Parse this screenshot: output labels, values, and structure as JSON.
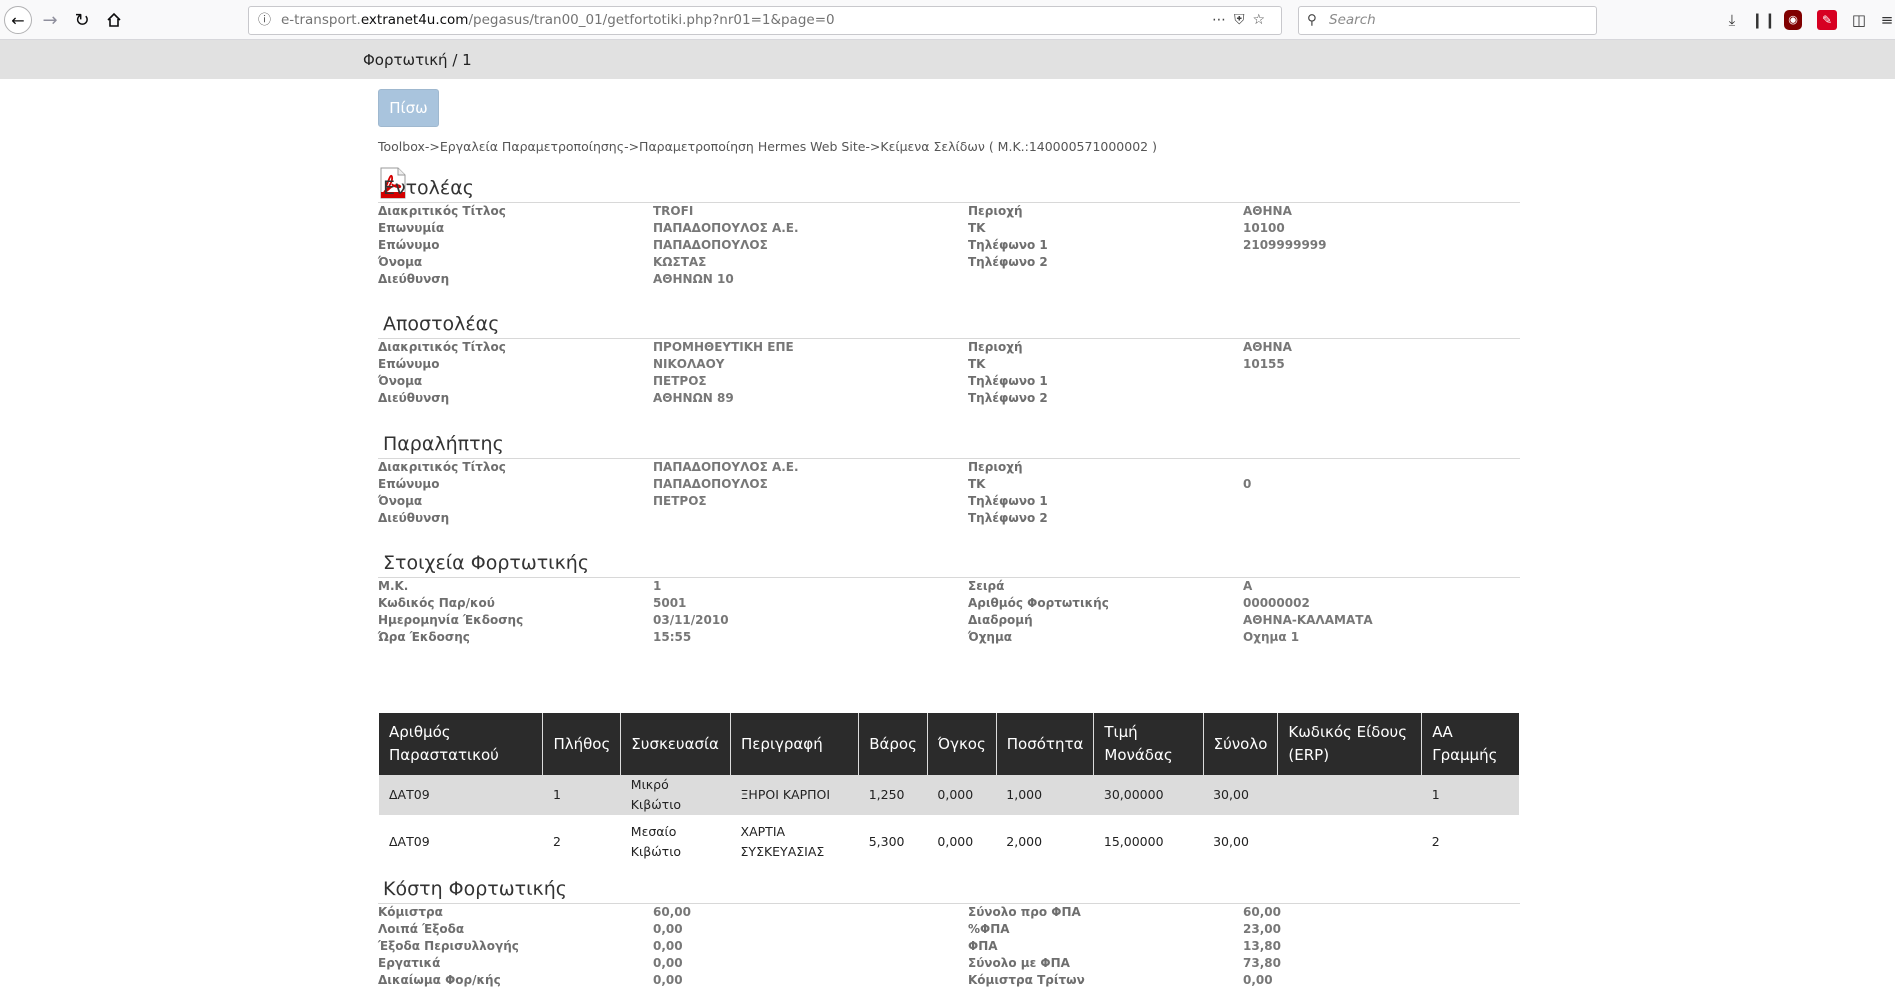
{
  "browser": {
    "url_prefix": "e-transport.",
    "url_host": "extranet4u.com",
    "url_path": "/pegasus/tran00_01/getfortotiki.php?nr01=1&page=0",
    "search_placeholder": "Search"
  },
  "header": {
    "title": "Φορτωτική / 1"
  },
  "back_button": "Πίσω",
  "breadcrumb": "Toolbox->Εργαλεία Παραμετροποίησης->Παραμετροποίηση Hermes Web Site->Κείμενα Σελίδων ( Μ.Κ.:140000571000002 )",
  "sections": {
    "entoleas": {
      "title": "Εντολέας",
      "rows": [
        {
          "k1": "Διακριτικός Τίτλος",
          "v1": "TROFI",
          "k2": "Περιοχή",
          "v2": "ΑΘΗΝΑ"
        },
        {
          "k1": "Επωνυμία",
          "v1": "ΠΑΠΑΔΟΠΟΥΛΟΣ Α.Ε.",
          "k2": "ΤΚ",
          "v2": "10100"
        },
        {
          "k1": "Επώνυμο",
          "v1": "ΠΑΠΑΔΟΠΟΥΛΟΣ",
          "k2": "Τηλέφωνο 1",
          "v2": "2109999999"
        },
        {
          "k1": "Όνομα",
          "v1": "ΚΩΣΤΑΣ",
          "k2": "Τηλέφωνο 2",
          "v2": ""
        },
        {
          "k1": "Διεύθυνση",
          "v1": "ΑΘΗΝΩΝ 10",
          "k2": "",
          "v2": ""
        }
      ]
    },
    "apostoleas": {
      "title": "Αποστολέας",
      "rows": [
        {
          "k1": "Διακριτικός Τίτλος",
          "v1": "ΠΡΟΜΗΘΕΥΤΙΚΗ ΕΠΕ",
          "k2": "Περιοχή",
          "v2": "ΑΘΗΝΑ"
        },
        {
          "k1": "Επώνυμο",
          "v1": "ΝΙΚΟΛΑΟΥ",
          "k2": "ΤΚ",
          "v2": "10155"
        },
        {
          "k1": "Όνομα",
          "v1": "ΠΕΤΡΟΣ",
          "k2": "Τηλέφωνο 1",
          "v2": ""
        },
        {
          "k1": "Διεύθυνση",
          "v1": "ΑΘΗΝΩΝ 89",
          "k2": "Τηλέφωνο 2",
          "v2": ""
        }
      ]
    },
    "paraliptis": {
      "title": "Παραλήπτης",
      "rows": [
        {
          "k1": "Διακριτικός Τίτλος",
          "v1": "ΠΑΠΑΔΟΠΟΥΛΟΣ Α.Ε.",
          "k2": "Περιοχή",
          "v2": ""
        },
        {
          "k1": "Επώνυμο",
          "v1": "ΠΑΠΑΔΟΠΟΥΛΟΣ",
          "k2": "ΤΚ",
          "v2": "0"
        },
        {
          "k1": "Όνομα",
          "v1": "ΠΕΤΡΟΣ",
          "k2": "Τηλέφωνο 1",
          "v2": ""
        },
        {
          "k1": "Διεύθυνση",
          "v1": "",
          "k2": "Τηλέφωνο 2",
          "v2": ""
        }
      ]
    },
    "stoixeia": {
      "title": "Στοιχεία Φορτωτικής",
      "rows": [
        {
          "k1": "Μ.Κ.",
          "v1": "1",
          "k2": "Σειρά",
          "v2": "Α"
        },
        {
          "k1": "Κωδικός Παρ/κού",
          "v1": "5001",
          "k2": "Αριθμός Φορτωτικής",
          "v2": "00000002"
        },
        {
          "k1": "Ημερομηνία Έκδοσης",
          "v1": "03/11/2010",
          "k2": "Διαδρομή",
          "v2": "ΑΘΗΝΑ-ΚΑΛΑΜΑΤΑ"
        },
        {
          "k1": "Ώρα Έκδοσης",
          "v1": "15:55",
          "k2": "Όχημα",
          "v2": "Οχημα 1"
        }
      ]
    },
    "kosti": {
      "title": "Κόστη Φορτωτικής",
      "rows": [
        {
          "k1": "Κόμιστρα",
          "v1": "60,00",
          "k2": "Σύνολο προ ΦΠΑ",
          "v2": "60,00"
        },
        {
          "k1": "Λοιπά Έξοδα",
          "v1": "0,00",
          "k2": "%ΦΠΑ",
          "v2": "23,00"
        },
        {
          "k1": "Έξοδα Περισυλλογής",
          "v1": "0,00",
          "k2": "ΦΠΑ",
          "v2": "13,80"
        },
        {
          "k1": "Εργατικά",
          "v1": "0,00",
          "k2": "Σύνολο με ΦΠΑ",
          "v2": "73,80"
        },
        {
          "k1": "Δικαίωμα Φορ/κής",
          "v1": "0,00",
          "k2": "Κόμιστρα Τρίτων",
          "v2": "0,00"
        }
      ]
    }
  },
  "items_table": {
    "headers": [
      "Αριθμός Παραστατικού",
      "Πλήθος",
      "Συσκευασία",
      "Περιγραφή",
      "Βάρος",
      "Όγκος",
      "Ποσότητα",
      "Τιμή Μονάδας",
      "Σύνολο",
      "Κωδικός Είδους (ERP)",
      "ΑΑ Γραμμής"
    ],
    "rows": [
      [
        "ΔΑΤ09",
        "1",
        "Μικρό Κιβώτιο",
        "ΞΗΡΟΙ ΚΑΡΠΟΙ",
        "1,250",
        "0,000",
        "1,000",
        "30,00000",
        "30,00",
        "",
        "1"
      ],
      [
        "ΔΑΤ09",
        "2",
        "Μεσαίο Κιβώτιο",
        "ΧΑΡΤΙΑ ΣΥΣΚΕΥΑΣΙΑΣ",
        "5,300",
        "0,000",
        "2,000",
        "15,00000",
        "30,00",
        "",
        "2"
      ]
    ]
  }
}
